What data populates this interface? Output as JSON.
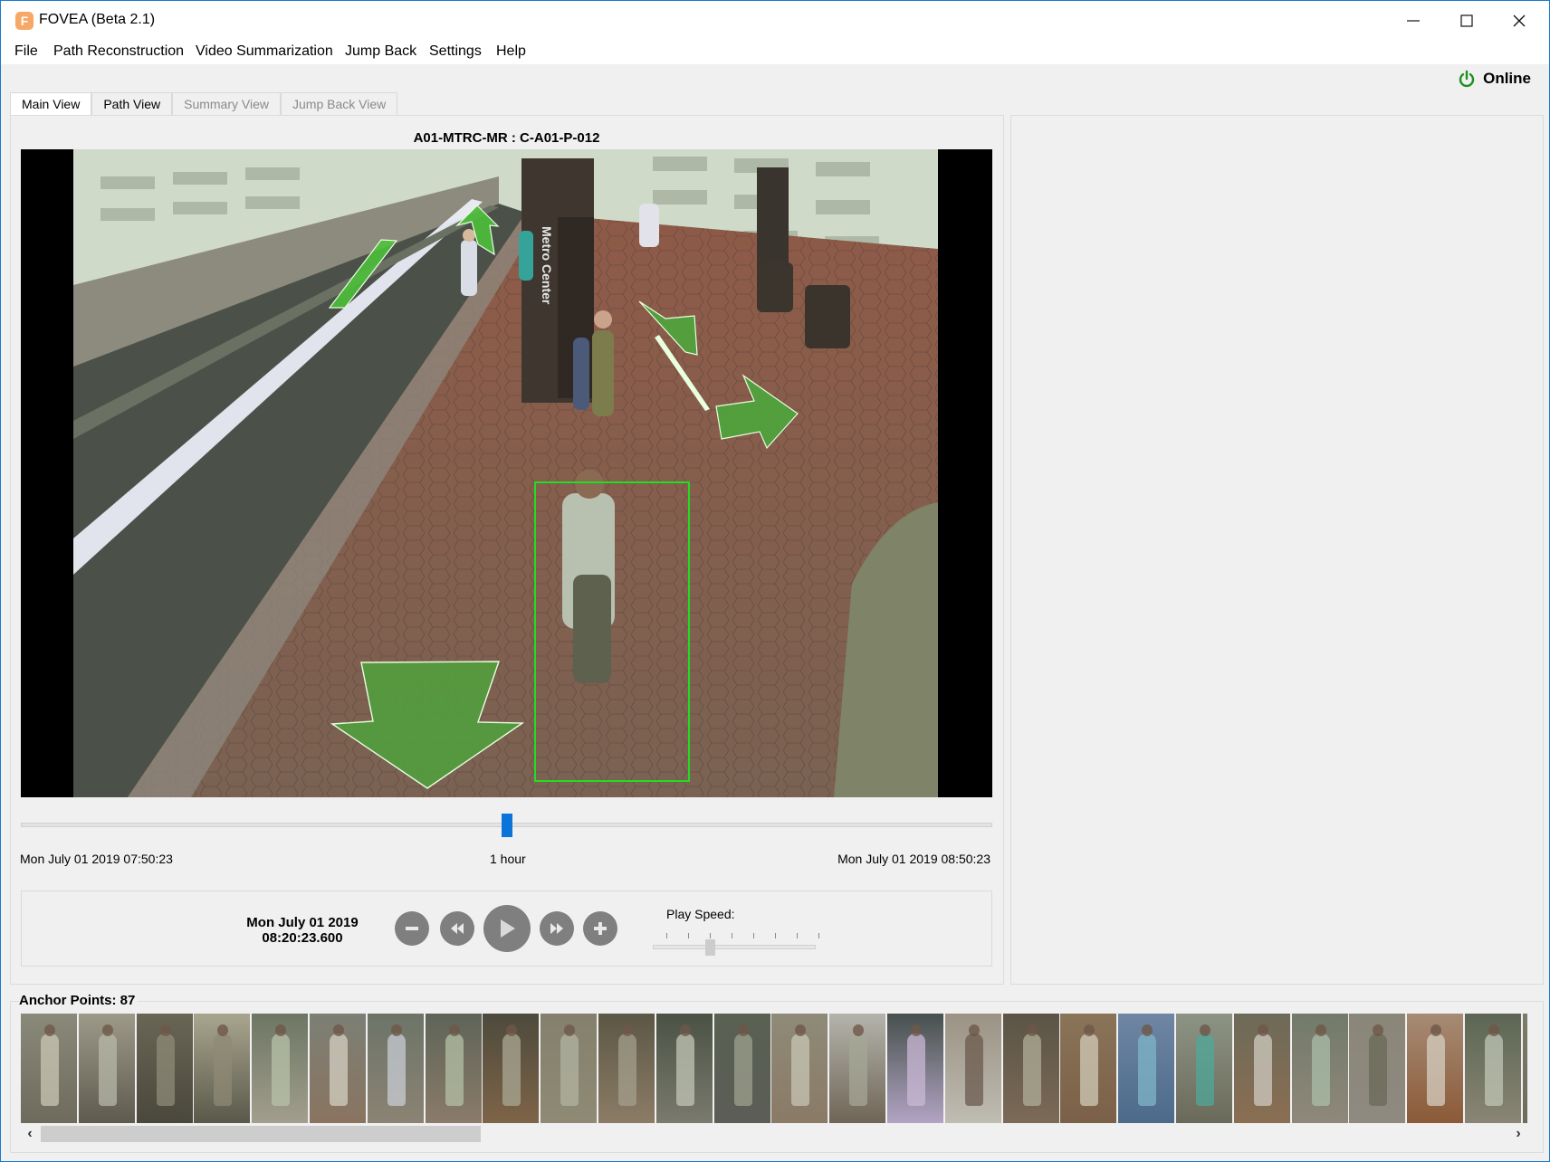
{
  "window": {
    "title": "FOVEA (Beta 2.1)",
    "app_icon_letter": "F",
    "controls": {
      "minimize": "—",
      "maximize": "☐",
      "close": "✕"
    }
  },
  "menu": [
    {
      "label": "File"
    },
    {
      "label": "Path Reconstruction"
    },
    {
      "label": "Video Summarization"
    },
    {
      "label": "Jump Back"
    },
    {
      "label": "Settings"
    },
    {
      "label": "Help"
    }
  ],
  "status": {
    "label": "Online",
    "icon": "power-icon",
    "color": "#1f8f1f"
  },
  "tabs": [
    {
      "label": "Main View",
      "state": "active"
    },
    {
      "label": "Path View",
      "state": "enabled"
    },
    {
      "label": "Summary View",
      "state": "disabled"
    },
    {
      "label": "Jump Back View",
      "state": "disabled"
    }
  ],
  "main_view": {
    "camera_title": "A01-MTRC-MR : C-A01-P-012",
    "video": {
      "scene": "Metro Center station platform",
      "sign_text": "Metro Center",
      "overlay_color": "#4caf3a",
      "detection_box_color": "#22dd22"
    },
    "timeline": {
      "start": "Mon July 01 2019 07:50:23",
      "span": "1 hour",
      "end": "Mon July 01 2019 08:50:23",
      "position_fraction": 0.5,
      "handle_color": "#0a74d8"
    },
    "playback": {
      "current_date": "Mon July 01 2019",
      "current_time": "08:20:23.600",
      "buttons": [
        {
          "name": "zoom-out-button",
          "icon": "minus-icon"
        },
        {
          "name": "rewind-button",
          "icon": "rewind-icon"
        },
        {
          "name": "play-button",
          "icon": "play-icon"
        },
        {
          "name": "fast-forward-button",
          "icon": "fast-forward-icon"
        },
        {
          "name": "zoom-in-button",
          "icon": "plus-icon"
        }
      ],
      "speed_label": "Play Speed:",
      "speed_ticks": 8,
      "speed_index": 2
    }
  },
  "anchor_points": {
    "label": "Anchor Points: 87",
    "count": 87,
    "thumbnails": [
      {
        "top": "#8a8a7a",
        "bottom": "#6e6a5c",
        "fig": "#c9c7b5"
      },
      {
        "top": "#9e9a8a",
        "bottom": "#5e5a4e",
        "fig": "#b7b8a9"
      },
      {
        "top": "#6a6656",
        "bottom": "#4a473c",
        "fig": "#8f8b78"
      },
      {
        "top": "#a8a68e",
        "bottom": "#5a5849",
        "fig": "#8d8a76"
      },
      {
        "top": "#6d7664",
        "bottom": "#a29e8d",
        "fig": "#b8c2a8"
      },
      {
        "top": "#7c7f75",
        "bottom": "#8a7460",
        "fig": "#d3d0c3"
      },
      {
        "top": "#6c7468",
        "bottom": "#8b8374",
        "fig": "#c8ccd4"
      },
      {
        "top": "#5e6458",
        "bottom": "#8a7b6a",
        "fig": "#b4c0a4"
      },
      {
        "top": "#4d4a3c",
        "bottom": "#7e6448",
        "fig": "#a9a894"
      },
      {
        "top": "#84806d",
        "bottom": "#8e8a74",
        "fig": "#b2b3a2"
      },
      {
        "top": "#5b5745",
        "bottom": "#8c7c66",
        "fig": "#a39f8b"
      },
      {
        "top": "#4a5244",
        "bottom": "#7a7a6e",
        "fig": "#c1c5b6"
      },
      {
        "top": "#5a6052",
        "bottom": "#5b5d56",
        "fig": "#9ea08e"
      },
      {
        "top": "#8f8a78",
        "bottom": "#8a7a66",
        "fig": "#c7c5b4"
      },
      {
        "top": "#b4b4ac",
        "bottom": "#6f6556",
        "fig": "#a5a796"
      },
      {
        "top": "#46504c",
        "bottom": "#b2a4c4",
        "fig": "#c9b8d6"
      },
      {
        "top": "#9b9284",
        "bottom": "#bfbcb2",
        "fig": "#6b5a4e"
      },
      {
        "top": "#5b5446",
        "bottom": "#7b6a56",
        "fig": "#b0ad98"
      },
      {
        "top": "#8a7458",
        "bottom": "#7a6048",
        "fig": "#d0cbb8"
      },
      {
        "top": "#6f86a4",
        "bottom": "#4c6a8a",
        "fig": "#7fb6c8"
      },
      {
        "top": "#8d9484",
        "bottom": "#6b6a5a",
        "fig": "#4fa89a"
      },
      {
        "top": "#6d6a58",
        "bottom": "#8a6e52",
        "fig": "#cfcbc0"
      },
      {
        "top": "#727a6a",
        "bottom": "#8f887a",
        "fig": "#a9bda8"
      },
      {
        "top": "#8a8678",
        "bottom": "#8f8a80",
        "fig": "#6a6a58"
      },
      {
        "top": "#a68b74",
        "bottom": "#8b5a38",
        "fig": "#d6cfc2"
      },
      {
        "top": "#5c6654",
        "bottom": "#8a8574",
        "fig": "#c0c6b6"
      },
      {
        "top": "#7e7a68",
        "bottom": "#6f6a5a",
        "fig": "#aaa896"
      }
    ],
    "scroll_fraction": 0.3
  }
}
